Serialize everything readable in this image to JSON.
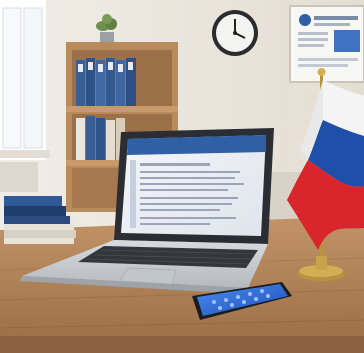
{
  "scene": {
    "kind": "photo",
    "objects": [
      "office-room",
      "laptop",
      "smartphone",
      "russian-flag",
      "wall-clock",
      "bookshelf",
      "binders",
      "books",
      "window",
      "wall-poster",
      "potted-plant",
      "wooden-desk"
    ]
  },
  "colors": {
    "wall": "#ece7df",
    "desk": "#b0825a",
    "desk_dark": "#8a6040",
    "shelf": "#b98a5c",
    "binder_blue": "#3b5f95",
    "laptop_body": "#c9ccd1",
    "laptop_bezel": "#2a2d33",
    "screen_header": "#2f5fa5",
    "flag_white": "#f4f4f4",
    "flag_blue": "#1f4fa8",
    "flag_red": "#d9262c",
    "brass": "#c9a24a",
    "phone_screen": "#2f6fd8"
  }
}
